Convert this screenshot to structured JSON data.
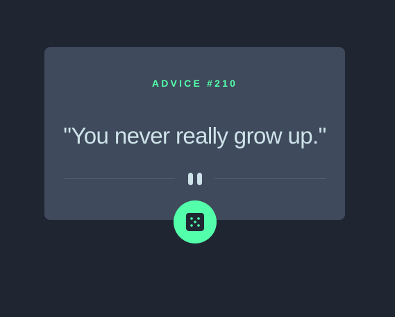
{
  "advice": {
    "label": "ADVICE #210",
    "quote": "\"You never really grow up.\""
  },
  "divider": {
    "icon": "pause-icon"
  },
  "dice_button": {
    "icon": "dice-icon"
  },
  "colors": {
    "background": "#1f2632",
    "card": "#3f4a5c",
    "accent": "#53ffaa",
    "quote_text": "#cee3e9",
    "divider_line": "#4f5d74"
  }
}
